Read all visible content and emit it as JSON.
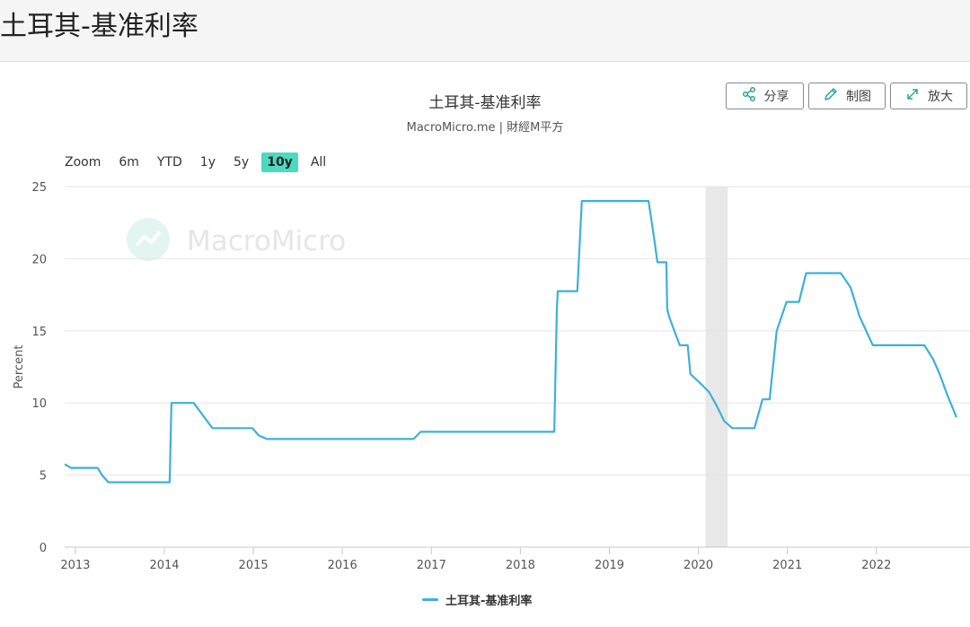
{
  "page": {
    "title": "土耳其-基准利率"
  },
  "toolbar": {
    "share_label": "分享",
    "draw_label": "制图",
    "enlarge_label": "放大"
  },
  "zoom": {
    "label": "Zoom",
    "options": [
      "6m",
      "YTD",
      "1y",
      "5y",
      "10y",
      "All"
    ],
    "selected": "10y"
  },
  "watermark": {
    "text": "MacroMicro"
  },
  "colors": {
    "series": "#3fb0d8",
    "active_zoom": "#4dd9c0",
    "recession": "#e8e8e8"
  },
  "chart_data": {
    "type": "line",
    "title": "土耳其-基准利率",
    "subtitle": "MacroMicro.me | 財經M平方",
    "xlabel": "",
    "ylabel": "Percent",
    "xlim": [
      2012.88,
      2022.9
    ],
    "ylim": [
      0,
      25
    ],
    "xticks": [
      "2013",
      "2014",
      "2015",
      "2016",
      "2017",
      "2018",
      "2019",
      "2020",
      "2021",
      "2022"
    ],
    "yticks": [
      0,
      5,
      10,
      15,
      20,
      25
    ],
    "grid": true,
    "legend_position": "bottom",
    "shaded_periods": [
      {
        "start": 2020.08,
        "end": 2020.33
      }
    ],
    "series": [
      {
        "name": "土耳其-基准利率",
        "x": [
          2012.88,
          2012.95,
          2013.25,
          2013.3,
          2013.37,
          2014.06,
          2014.08,
          2014.33,
          2014.42,
          2014.54,
          2014.99,
          2015.06,
          2015.15,
          2016.8,
          2016.88,
          2018.38,
          2018.41,
          2018.42,
          2018.64,
          2018.69,
          2019.44,
          2019.5,
          2019.54,
          2019.64,
          2019.65,
          2019.67,
          2019.79,
          2019.88,
          2019.91,
          2020.04,
          2020.12,
          2020.21,
          2020.29,
          2020.38,
          2020.63,
          2020.72,
          2020.8,
          2020.88,
          2020.99,
          2021.13,
          2021.21,
          2021.6,
          2021.71,
          2021.81,
          2021.96,
          2022.54,
          2022.64,
          2022.71,
          2022.8,
          2022.9
        ],
        "values": [
          5.75,
          5.5,
          5.5,
          5.0,
          4.5,
          4.5,
          10.0,
          10.0,
          9.25,
          8.25,
          8.25,
          7.75,
          7.5,
          7.5,
          8.0,
          8.0,
          16.5,
          17.75,
          17.75,
          24.0,
          24.0,
          21.5,
          19.75,
          19.75,
          16.5,
          16.0,
          14.0,
          14.0,
          12.0,
          11.25,
          10.75,
          9.75,
          8.75,
          8.25,
          8.25,
          10.25,
          10.25,
          15.0,
          17.0,
          17.0,
          19.0,
          19.0,
          18.0,
          16.0,
          14.0,
          14.0,
          13.0,
          12.0,
          10.5,
          9.0
        ]
      }
    ]
  }
}
